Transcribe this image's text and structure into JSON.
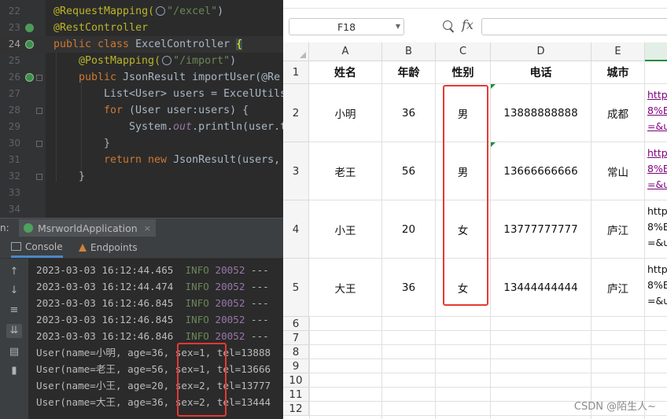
{
  "editor": {
    "lines": [
      {
        "num": "22",
        "t1": "@RequestMapping(",
        "t2": "\"/excel\"",
        "t3": ")"
      },
      {
        "num": "23",
        "t1": "@RestController"
      },
      {
        "num": "24",
        "t1": "public class ",
        "t2": "ExcelController ",
        "t3": "{"
      },
      {
        "num": "25",
        "t1": "@PostMapping(",
        "t2": "\"/import\"",
        "t3": ")"
      },
      {
        "num": "26",
        "t1": "public ",
        "t2": "JsonResult importUser(@Re"
      },
      {
        "num": "27",
        "t1": "List<User> users = ExcelUtils"
      },
      {
        "num": "28",
        "t1": "for ",
        "t2": "(User user:users) {"
      },
      {
        "num": "29",
        "t1": "System.",
        "t2": "out",
        "t3": ".println(user.t"
      },
      {
        "num": "30",
        "t1": "}"
      },
      {
        "num": "31",
        "t1": "return new ",
        "t2": "JsonResult(users,"
      },
      {
        "num": "32",
        "t1": "}"
      },
      {
        "num": "33",
        "t1": ""
      },
      {
        "num": "34",
        "t1": ""
      }
    ]
  },
  "run": {
    "label": "n:",
    "app_tab": "MsrworldApplication",
    "close": "×",
    "tab_console": "Console",
    "tab_endpoints": "Endpoints"
  },
  "console": {
    "logs": [
      {
        "ts": "2023-03-03 16:12:44.465",
        "level": "INFO",
        "pid": "20052",
        "dash": "---"
      },
      {
        "ts": "2023-03-03 16:12:44.474",
        "level": "INFO",
        "pid": "20052",
        "dash": "---"
      },
      {
        "ts": "2023-03-03 16:12:46.845",
        "level": "INFO",
        "pid": "20052",
        "dash": "---"
      },
      {
        "ts": "2023-03-03 16:12:46.845",
        "level": "INFO",
        "pid": "20052",
        "dash": "---"
      },
      {
        "ts": "2023-03-03 16:12:46.846",
        "level": "INFO",
        "pid": "20052",
        "dash": "---"
      }
    ],
    "users": [
      "User(name=小明, age=36, sex=1, tel=13888",
      "User(name=老王, age=56, sex=1, tel=13666",
      "User(name=小王, age=20, sex=2, tel=13777",
      "User(name=大王, age=36, sex=2, tel=13444"
    ]
  },
  "toolbar_icons": [
    "up-arrow-icon",
    "down-arrow-icon",
    "wrap-icon",
    "scroll-end-icon",
    "print-icon",
    "trash-icon"
  ],
  "spreadsheet": {
    "name_box": "F18",
    "fx": "fx",
    "columns": [
      "A",
      "B",
      "C",
      "D",
      "E"
    ],
    "header_row": {
      "row": "1",
      "name": "姓名",
      "age": "年龄",
      "sex": "性别",
      "tel": "电话",
      "city": "城市"
    },
    "rows": [
      {
        "row": "2",
        "name": "小明",
        "age": "36",
        "sex": "男",
        "tel": "13888888888",
        "city": "成都",
        "f1": "http",
        "f2": "8%E",
        "f3": "=&u",
        "link": true
      },
      {
        "row": "3",
        "name": "老王",
        "age": "56",
        "sex": "男",
        "tel": "13666666666",
        "city": "常山",
        "f1": "http",
        "f2": "8%E",
        "f3": "=&u",
        "link": true
      },
      {
        "row": "4",
        "name": "小王",
        "age": "20",
        "sex": "女",
        "tel": "13777777777",
        "city": "庐江",
        "f1": "http",
        "f2": "8%E",
        "f3": "=&u",
        "link": false
      },
      {
        "row": "5",
        "name": "大王",
        "age": "36",
        "sex": "女",
        "tel": "13444444444",
        "city": "庐江",
        "f1": "http",
        "f2": "8%E",
        "f3": "=&u",
        "link": false
      }
    ],
    "empty_rows": [
      "6",
      "7",
      "8",
      "9",
      "10",
      "11",
      "12"
    ]
  },
  "watermark": "CSDN @陌生人~",
  "colors": {
    "highlight_box": "#e53935",
    "ide_bg": "#2b2b2b",
    "link": "#800080"
  }
}
